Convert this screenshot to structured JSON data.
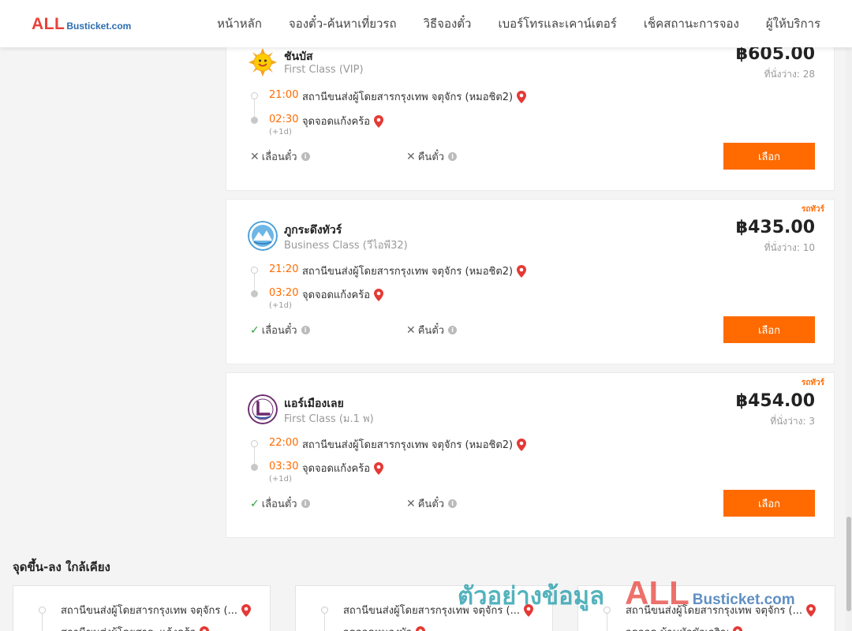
{
  "header": {
    "logo": {
      "all": "ALL",
      "rest": "Busticket.com"
    },
    "nav": [
      "หน้าหลัก",
      "จองตั๋ว-ค้นหาเที่ยวรถ",
      "วิธีจองตั๋ว",
      "เบอร์โทรและเคาน์เตอร์",
      "เช็คสถานะการจอง",
      "ผู้ให้บริการ"
    ]
  },
  "trips": [
    {
      "tag": "",
      "operator": "ชันบัส",
      "bus_class": "First Class (VIP)",
      "price": "฿605.00",
      "seats": "ที่นั่งว่าง: 28",
      "depart_time": "21:00",
      "depart_place": "สถานีขนส่งผู้โดยสารกรุงเทพ จตุจักร (หมอชิต2)",
      "arrive_time": "02:30",
      "arrive_place": "จุดจอดแก้งคร้อ",
      "next_day": "(+1d)",
      "change_label": "เลื่อนตั๋ว",
      "change_allowed": false,
      "refund_label": "คืนตั๋ว",
      "refund_allowed": false,
      "select_label": "เลือก"
    },
    {
      "tag": "รถทัวร์",
      "operator": "ภูกระดึงทัวร์",
      "bus_class": "Business Class (วีไอพี32)",
      "price": "฿435.00",
      "seats": "ที่นั่งว่าง: 10",
      "depart_time": "21:20",
      "depart_place": "สถานีขนส่งผู้โดยสารกรุงเทพ จตุจักร (หมอชิต2)",
      "arrive_time": "03:20",
      "arrive_place": "จุดจอดแก้งคร้อ",
      "next_day": "(+1d)",
      "change_label": "เลื่อนตั๋ว",
      "change_allowed": true,
      "refund_label": "คืนตั๋ว",
      "refund_allowed": false,
      "select_label": "เลือก"
    },
    {
      "tag": "รถทัวร์",
      "operator": "แอร์เมืองเลย",
      "bus_class": "First Class (ม.1 พ)",
      "price": "฿454.00",
      "seats": "ที่นั่งว่าง: 3",
      "depart_time": "22:00",
      "depart_place": "สถานีขนส่งผู้โดยสารกรุงเทพ จตุจักร (หมอชิต2)",
      "arrive_time": "03:30",
      "arrive_place": "จุดจอดแก้งคร้อ",
      "next_day": "(+1d)",
      "change_label": "เลื่อนตั๋ว",
      "change_allowed": true,
      "refund_label": "คืนตั๋ว",
      "refund_allowed": false,
      "select_label": "เลือก"
    }
  ],
  "nearby": {
    "title": "จุดขึ้น-ลง ใกล้เคียง",
    "cards": [
      {
        "from": "สถานีขนส่งผู้โดยสารกรุงเทพ จตุจักร (...",
        "to": "สถานีขนส่งผู้โดยสาร..แก้งคร้อ"
      },
      {
        "from": "สถานีขนส่งผู้โดยสารกรุงเทพ จตุจักร (...",
        "to": "จุดจอดหนองบัว"
      },
      {
        "from": "สถานีขนส่งผู้โดยสารกรุงเทพ จตุจักร (...",
        "to": "จุดจอด บ้านหัวขัวเจริญ"
      }
    ]
  },
  "watermark": {
    "text": "ตัวอย่างข้อมูล",
    "all": "ALL",
    "rest": "Busticket.com"
  },
  "colors": {
    "accent": "#ff6b00",
    "brand_red": "#e8423a",
    "brand_blue": "#2b6cb0",
    "check": "#2e9e3e",
    "pin": "#e53935"
  }
}
